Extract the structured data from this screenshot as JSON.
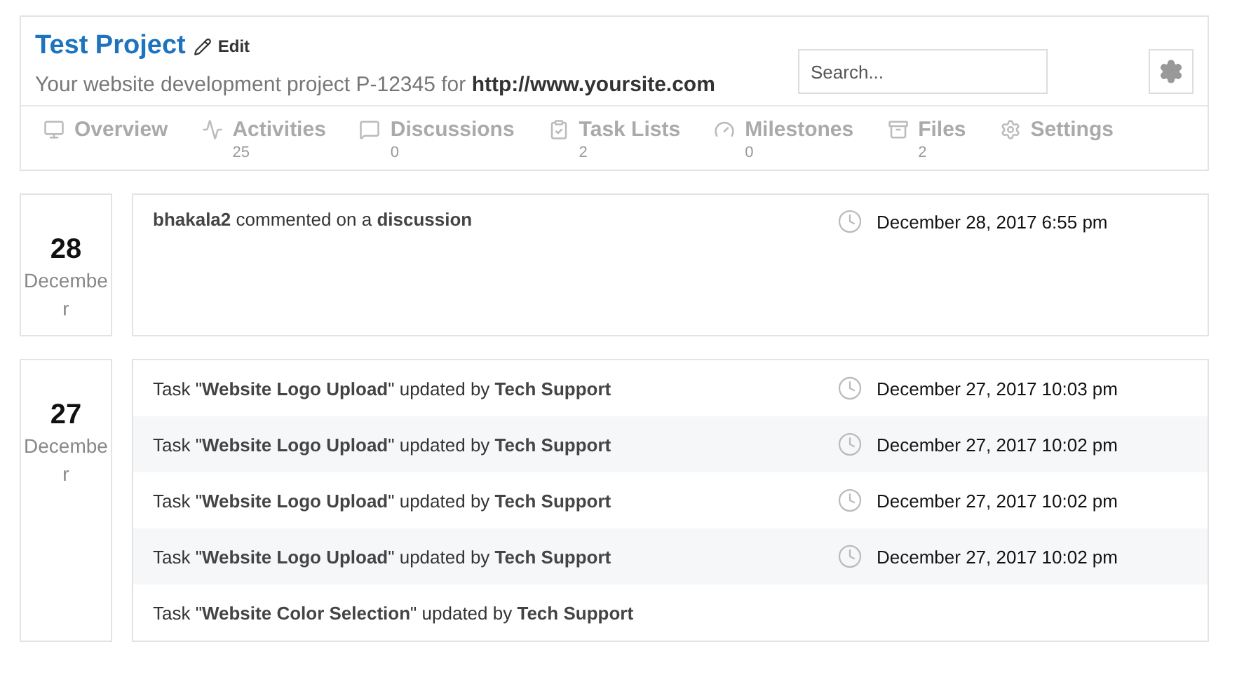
{
  "project": {
    "title": "Test Project",
    "edit_label": "Edit",
    "description": "Your website development project P-12345 for **http://www.yoursite.com**"
  },
  "search": {
    "placeholder": "Search..."
  },
  "tabs": [
    {
      "label": "Overview"
    },
    {
      "label": "Activities",
      "count": "25"
    },
    {
      "label": "Discussions",
      "count": "0"
    },
    {
      "label": "Task Lists",
      "count": "2"
    },
    {
      "label": "Milestones",
      "count": "0"
    },
    {
      "label": "Files",
      "count": "2"
    },
    {
      "label": "Settings"
    }
  ],
  "days": [
    {
      "day": "28",
      "month": "December",
      "entries": [
        {
          "text": "**bhakala2** commented on a **discussion**",
          "time": "December 28, 2017 6:55 pm"
        }
      ]
    },
    {
      "day": "27",
      "month": "December",
      "entries": [
        {
          "text": "Task \"**Website Logo Upload**\" updated by **Tech Support**",
          "time": "December 27, 2017 10:03 pm"
        },
        {
          "text": "Task \"**Website Logo Upload**\" updated by **Tech Support**",
          "time": "December 27, 2017 10:02 pm"
        },
        {
          "text": "Task \"**Website Logo Upload**\" updated by **Tech Support**",
          "time": "December 27, 2017 10:02 pm"
        },
        {
          "text": "Task \"**Website Logo Upload**\" updated by **Tech Support**",
          "time": "December 27, 2017 10:02 pm"
        },
        {
          "text": "Task \"**Website Color Selection**\" updated by **Tech Support**"
        }
      ]
    }
  ]
}
